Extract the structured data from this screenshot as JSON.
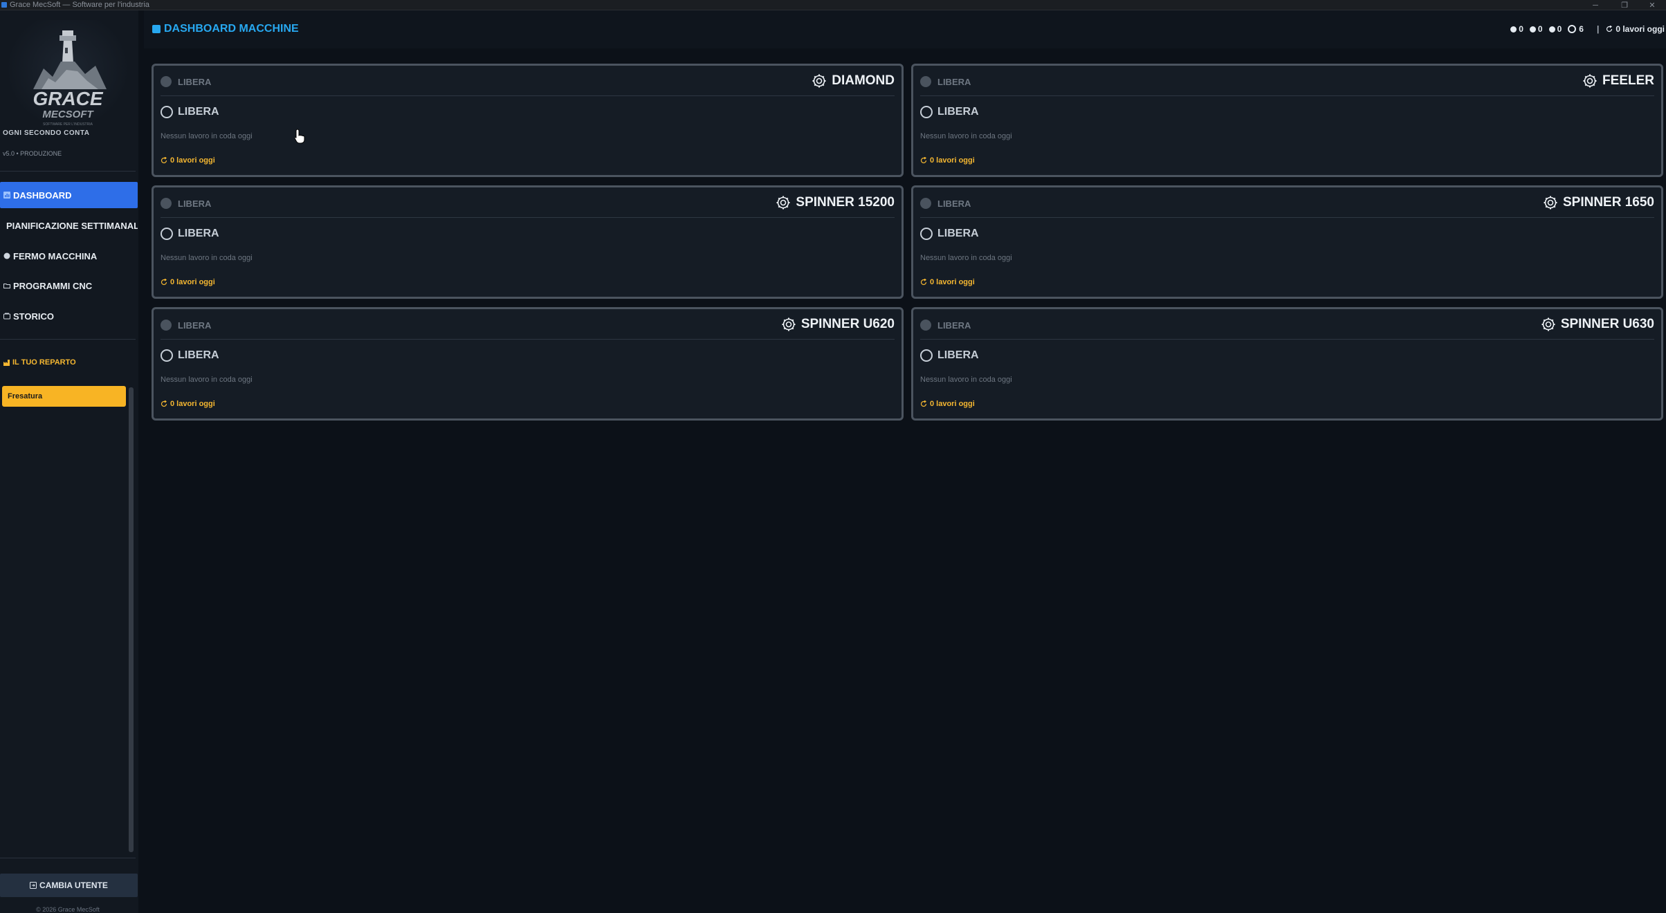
{
  "window": {
    "title": "Grace MecSoft — Software per l'industria",
    "controls": [
      "─",
      "❐",
      "✕"
    ]
  },
  "sidebar": {
    "logo": {
      "brand": "GRACE",
      "sub": "MECSOFT",
      "tag": "SOFTWARE PER L'INDUSTRIA"
    },
    "tagline": "OGNI SECONDO CONTA",
    "version": "v5.0 • PRODUZIONE",
    "nav": [
      {
        "label": "DASHBOARD",
        "icon": "dashboard-icon",
        "active": true
      },
      {
        "label": "PIANIFICAZIONE SETTIMANALE",
        "icon": "calendar-icon",
        "active": false
      },
      {
        "label": "FERMO MACCHINA",
        "icon": "stop-icon",
        "active": false
      },
      {
        "label": "PROGRAMMI CNC",
        "icon": "folder-icon",
        "active": false
      },
      {
        "label": "STORICO",
        "icon": "history-icon",
        "active": false
      }
    ],
    "section_label": "IL TUO REPARTO",
    "reparto": "Fresatura",
    "change_user": "CAMBIA UTENTE",
    "copyright": "© 2026 Grace MecSoft"
  },
  "header": {
    "title": "DASHBOARD MACCHINE",
    "stats": {
      "count_1": "0",
      "count_2": "0",
      "count_3": "0",
      "free_count": "6",
      "divider": "|",
      "jobs_today": "0 lavori oggi"
    }
  },
  "machines": [
    {
      "name": "DIAMOND",
      "status_label": "LIBERA",
      "state": "LIBERA",
      "queue": "Nessun lavoro in coda oggi",
      "jobs": "0 lavori oggi"
    },
    {
      "name": "FEELER",
      "status_label": "LIBERA",
      "state": "LIBERA",
      "queue": "Nessun lavoro in coda oggi",
      "jobs": "0 lavori oggi"
    },
    {
      "name": "SPINNER 15200",
      "status_label": "LIBERA",
      "state": "LIBERA",
      "queue": "Nessun lavoro in coda oggi",
      "jobs": "0 lavori oggi"
    },
    {
      "name": "SPINNER 1650",
      "status_label": "LIBERA",
      "state": "LIBERA",
      "queue": "Nessun lavoro in coda oggi",
      "jobs": "0 lavori oggi"
    },
    {
      "name": "SPINNER U620",
      "status_label": "LIBERA",
      "state": "LIBERA",
      "queue": "Nessun lavoro in coda oggi",
      "jobs": "0 lavori oggi"
    },
    {
      "name": "SPINNER U630",
      "status_label": "LIBERA",
      "state": "LIBERA",
      "queue": "Nessun lavoro in coda oggi",
      "jobs": "0 lavori oggi"
    }
  ],
  "colors": {
    "accent": "#2e6ee8",
    "title_blue": "#27a8f0",
    "warning": "#f5b731",
    "background": "#0c1118"
  }
}
